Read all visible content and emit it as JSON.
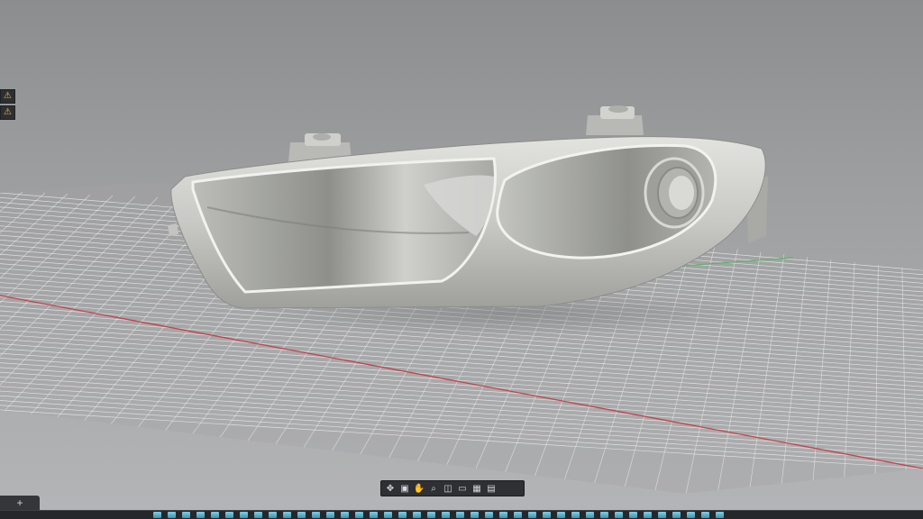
{
  "viewport": {
    "background": "#9b9c9d",
    "grid_color": "#e9eaea",
    "x_axis_color": "#c4424a",
    "y_axis_color": "#5fb36a",
    "model_color": "#c9cac6"
  },
  "side_warnings": [
    {
      "icon": "warning-icon",
      "glyph": "⚠"
    },
    {
      "icon": "warning-icon",
      "glyph": "⚠"
    }
  ],
  "tabs": {
    "add_label": "+"
  },
  "view_toolbar": {
    "items": [
      {
        "icon": "navigate-icon",
        "glyph": "✥"
      },
      {
        "icon": "camera-icon",
        "glyph": "▣"
      },
      {
        "icon": "pan-hand-icon",
        "glyph": "✋"
      },
      {
        "icon": "zoom-icon",
        "glyph": "⌕"
      },
      {
        "icon": "fit-view-icon",
        "glyph": "◫"
      },
      {
        "icon": "display-style-icon",
        "glyph": "▭"
      },
      {
        "icon": "grid-icon",
        "glyph": "▦"
      },
      {
        "icon": "viewports-icon",
        "glyph": "▤"
      }
    ]
  },
  "bottom_shelf_count": 40
}
